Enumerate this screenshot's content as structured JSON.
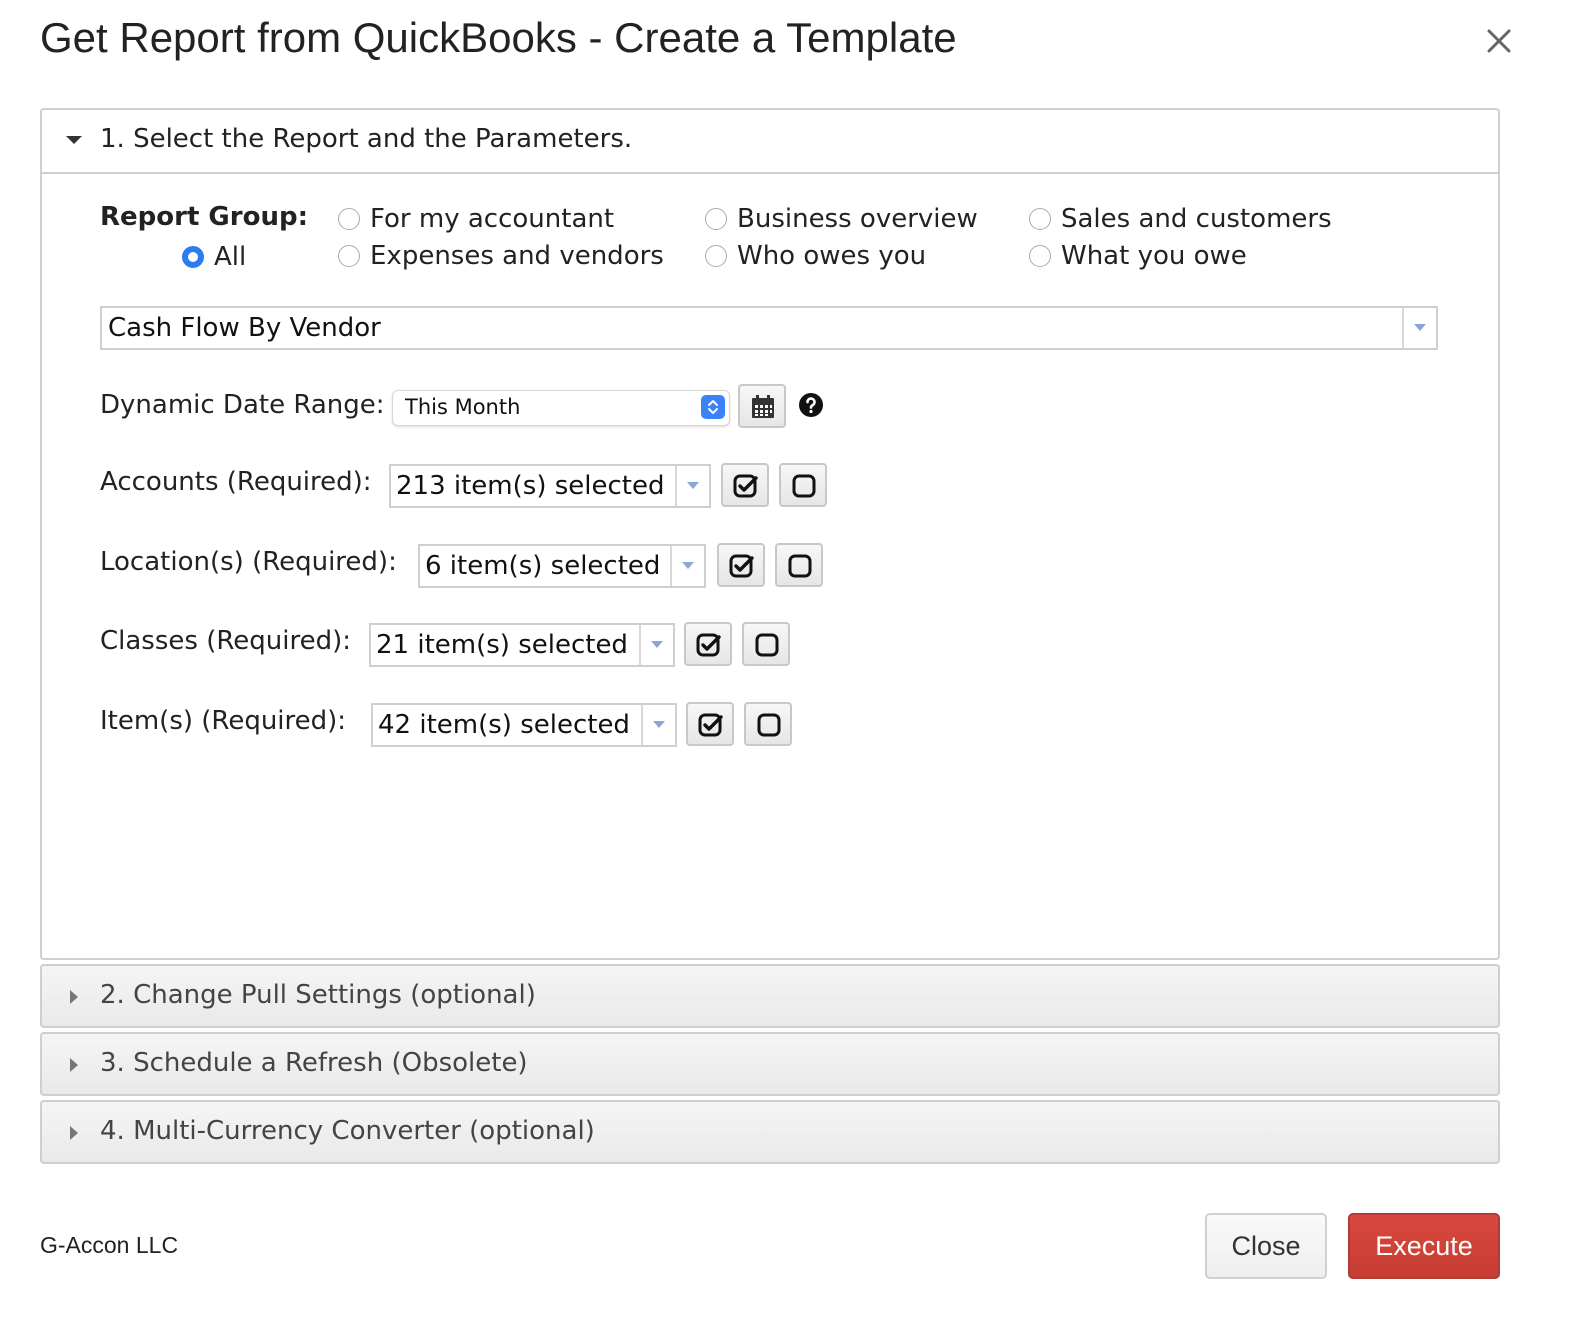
{
  "dialog": {
    "title": "Get Report from QuickBooks - Create a Template"
  },
  "sections": {
    "s1": "1. Select the Report and the Parameters.",
    "s2": "2. Change Pull Settings (optional)",
    "s3": "3. Schedule a Refresh (Obsolete)",
    "s4": "4. Multi-Currency Converter (optional)"
  },
  "report_group": {
    "label": "Report Group:",
    "options": [
      {
        "label": "All",
        "selected": true
      },
      {
        "label": "For my accountant",
        "selected": false
      },
      {
        "label": "Expenses and vendors",
        "selected": false
      },
      {
        "label": "Business overview",
        "selected": false
      },
      {
        "label": "Who owes you",
        "selected": false
      },
      {
        "label": "Sales and customers",
        "selected": false
      },
      {
        "label": "What you owe",
        "selected": false
      }
    ]
  },
  "report_select": {
    "value": "Cash Flow By Vendor"
  },
  "date_range": {
    "label": "Dynamic Date Range:",
    "value": "This Month"
  },
  "filters": {
    "accounts": {
      "label": "Accounts (Required):",
      "value": "213 item(s) selected"
    },
    "locations": {
      "label": "Location(s) (Required):",
      "value": "6 item(s) selected"
    },
    "classes": {
      "label": "Classes (Required):",
      "value": "21 item(s) selected"
    },
    "items": {
      "label": "Item(s) (Required):",
      "value": "42 item(s) selected"
    }
  },
  "footer": {
    "company": "G-Accon LLC",
    "close_label": "Close",
    "execute_label": "Execute"
  },
  "colors": {
    "accent": "#2c7cf0",
    "execute": "#c63d33"
  }
}
